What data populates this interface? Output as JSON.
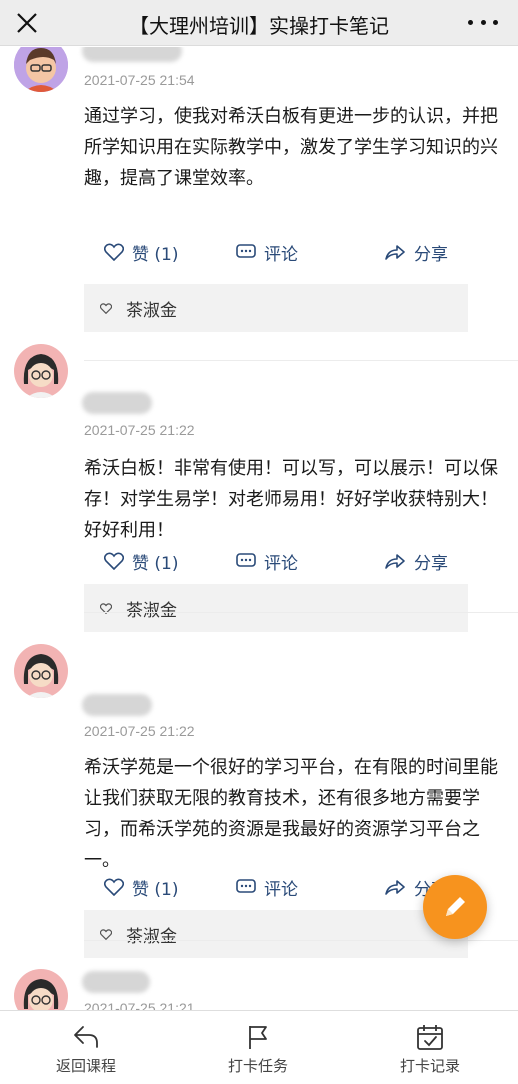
{
  "header": {
    "title": "【大理州培训】实操打卡笔记",
    "close_icon": "close-icon",
    "more_icon": "more-icon"
  },
  "posts": [
    {
      "timestamp": "2021-07-25 21:54",
      "content": "通过学习，使我对希沃白板有更进一步的认识，并把所学知识用在实际教学中，激发了学生学习知识的兴趣，提高了课堂效率。",
      "like_label": "赞 (1)",
      "comment_label": "评论",
      "share_label": "分享",
      "liked_by": "茶淑金"
    },
    {
      "timestamp": "2021-07-25 21:22",
      "content": "希沃白板！非常有使用！可以写，可以展示！可以保存！对学生易学！对老师易用！好好学收获特别大！好好利用！",
      "like_label": "赞 (1)",
      "comment_label": "评论",
      "share_label": "分享",
      "liked_by": "茶淑金"
    },
    {
      "timestamp": "2021-07-25 21:22",
      "content": "希沃学苑是一个很好的学习平台，在有限的时间里能让我们获取无限的教育技术，还有很多地方需要学习，而希沃学苑的资源是我最好的资源学习平台之一。",
      "like_label": "赞 (1)",
      "comment_label": "评论",
      "share_label": "分享",
      "liked_by": "茶淑金"
    },
    {
      "timestamp": "2021-07-25 21:21"
    }
  ],
  "fab_icon": "edit-pencil-icon",
  "bottom_nav": [
    {
      "label": "返回课程",
      "icon": "return-arrow-icon"
    },
    {
      "label": "打卡任务",
      "icon": "flag-icon"
    },
    {
      "label": "打卡记录",
      "icon": "calendar-check-icon"
    }
  ],
  "colors": {
    "accent_link": "#2a4a78",
    "fab": "#f7931e",
    "header_bg": "#ededed"
  }
}
